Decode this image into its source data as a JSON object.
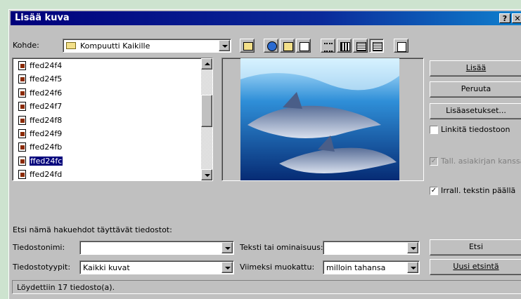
{
  "window": {
    "title": "Lisää kuva",
    "help_label": "?",
    "close_label": "✕"
  },
  "lookin": {
    "label": "Kohde:",
    "value": "Kompuutti Kaikille"
  },
  "files": [
    {
      "name": "ffed24f4",
      "selected": false
    },
    {
      "name": "ffed24f5",
      "selected": false
    },
    {
      "name": "ffed24f6",
      "selected": false
    },
    {
      "name": "ffed24f7",
      "selected": false
    },
    {
      "name": "ffed24f8",
      "selected": false
    },
    {
      "name": "ffed24f9",
      "selected": false
    },
    {
      "name": "ffed24fb",
      "selected": false
    },
    {
      "name": "ffed24fc",
      "selected": true
    },
    {
      "name": "ffed24fd",
      "selected": false
    }
  ],
  "buttons": {
    "insert": "Lisää",
    "cancel": "Peruuta",
    "advanced": "Lisäasetukset...",
    "find": "Etsi",
    "new_search": "Uusi etsintä"
  },
  "options": {
    "link": {
      "label": "Linkitä tiedostoon",
      "checked": false,
      "disabled": false
    },
    "save_with": {
      "label": "Tall. asiakirjan kanssa",
      "checked": true,
      "disabled": true
    },
    "float": {
      "label": "Irrall. tekstin päällä",
      "checked": true,
      "disabled": false
    }
  },
  "search": {
    "heading": "Etsi nämä hakuehdot täyttävät tiedostot:",
    "filename_label": "Tiedostonimi:",
    "filename_value": "",
    "filetype_label": "Tiedostotyypit:",
    "filetype_value": "Kaikki kuvat",
    "text_label": "Teksti tai ominaisuus:",
    "text_value": "",
    "modified_label": "Viimeksi muokattu:",
    "modified_value": "milloin tahansa"
  },
  "status": "Löydettiin 17 tiedosto(a).",
  "icons": [
    "folder-icon",
    "up-folder-icon",
    "search-web-icon",
    "favorites-icon",
    "add-to-favorites-icon",
    "list-view-icon",
    "details-view-icon",
    "properties-view-icon",
    "preview-view-icon",
    "commands-icon"
  ],
  "colors": {
    "title_start": "#00007b",
    "title_end": "#1084d0",
    "selection": "#00007b",
    "background": "#cde3cf"
  }
}
